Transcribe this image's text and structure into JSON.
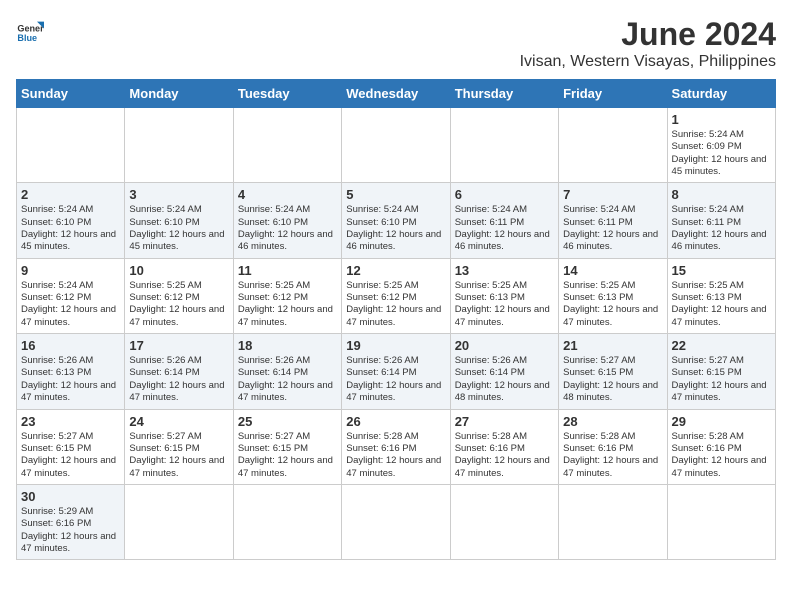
{
  "header": {
    "logo_general": "General",
    "logo_blue": "Blue",
    "month_title": "June 2024",
    "subtitle": "Ivisan, Western Visayas, Philippines"
  },
  "weekdays": [
    "Sunday",
    "Monday",
    "Tuesday",
    "Wednesday",
    "Thursday",
    "Friday",
    "Saturday"
  ],
  "days": [
    {
      "date": "1",
      "sunrise": "5:24 AM",
      "sunset": "6:09 PM",
      "daylight": "12 hours and 45 minutes."
    },
    {
      "date": "2",
      "sunrise": "5:24 AM",
      "sunset": "6:10 PM",
      "daylight": "12 hours and 45 minutes."
    },
    {
      "date": "3",
      "sunrise": "5:24 AM",
      "sunset": "6:10 PM",
      "daylight": "12 hours and 45 minutes."
    },
    {
      "date": "4",
      "sunrise": "5:24 AM",
      "sunset": "6:10 PM",
      "daylight": "12 hours and 46 minutes."
    },
    {
      "date": "5",
      "sunrise": "5:24 AM",
      "sunset": "6:10 PM",
      "daylight": "12 hours and 46 minutes."
    },
    {
      "date": "6",
      "sunrise": "5:24 AM",
      "sunset": "6:11 PM",
      "daylight": "12 hours and 46 minutes."
    },
    {
      "date": "7",
      "sunrise": "5:24 AM",
      "sunset": "6:11 PM",
      "daylight": "12 hours and 46 minutes."
    },
    {
      "date": "8",
      "sunrise": "5:24 AM",
      "sunset": "6:11 PM",
      "daylight": "12 hours and 46 minutes."
    },
    {
      "date": "9",
      "sunrise": "5:24 AM",
      "sunset": "6:12 PM",
      "daylight": "12 hours and 47 minutes."
    },
    {
      "date": "10",
      "sunrise": "5:25 AM",
      "sunset": "6:12 PM",
      "daylight": "12 hours and 47 minutes."
    },
    {
      "date": "11",
      "sunrise": "5:25 AM",
      "sunset": "6:12 PM",
      "daylight": "12 hours and 47 minutes."
    },
    {
      "date": "12",
      "sunrise": "5:25 AM",
      "sunset": "6:12 PM",
      "daylight": "12 hours and 47 minutes."
    },
    {
      "date": "13",
      "sunrise": "5:25 AM",
      "sunset": "6:13 PM",
      "daylight": "12 hours and 47 minutes."
    },
    {
      "date": "14",
      "sunrise": "5:25 AM",
      "sunset": "6:13 PM",
      "daylight": "12 hours and 47 minutes."
    },
    {
      "date": "15",
      "sunrise": "5:25 AM",
      "sunset": "6:13 PM",
      "daylight": "12 hours and 47 minutes."
    },
    {
      "date": "16",
      "sunrise": "5:26 AM",
      "sunset": "6:13 PM",
      "daylight": "12 hours and 47 minutes."
    },
    {
      "date": "17",
      "sunrise": "5:26 AM",
      "sunset": "6:14 PM",
      "daylight": "12 hours and 47 minutes."
    },
    {
      "date": "18",
      "sunrise": "5:26 AM",
      "sunset": "6:14 PM",
      "daylight": "12 hours and 47 minutes."
    },
    {
      "date": "19",
      "sunrise": "5:26 AM",
      "sunset": "6:14 PM",
      "daylight": "12 hours and 47 minutes."
    },
    {
      "date": "20",
      "sunrise": "5:26 AM",
      "sunset": "6:14 PM",
      "daylight": "12 hours and 48 minutes."
    },
    {
      "date": "21",
      "sunrise": "5:27 AM",
      "sunset": "6:15 PM",
      "daylight": "12 hours and 48 minutes."
    },
    {
      "date": "22",
      "sunrise": "5:27 AM",
      "sunset": "6:15 PM",
      "daylight": "12 hours and 47 minutes."
    },
    {
      "date": "23",
      "sunrise": "5:27 AM",
      "sunset": "6:15 PM",
      "daylight": "12 hours and 47 minutes."
    },
    {
      "date": "24",
      "sunrise": "5:27 AM",
      "sunset": "6:15 PM",
      "daylight": "12 hours and 47 minutes."
    },
    {
      "date": "25",
      "sunrise": "5:27 AM",
      "sunset": "6:15 PM",
      "daylight": "12 hours and 47 minutes."
    },
    {
      "date": "26",
      "sunrise": "5:28 AM",
      "sunset": "6:16 PM",
      "daylight": "12 hours and 47 minutes."
    },
    {
      "date": "27",
      "sunrise": "5:28 AM",
      "sunset": "6:16 PM",
      "daylight": "12 hours and 47 minutes."
    },
    {
      "date": "28",
      "sunrise": "5:28 AM",
      "sunset": "6:16 PM",
      "daylight": "12 hours and 47 minutes."
    },
    {
      "date": "29",
      "sunrise": "5:28 AM",
      "sunset": "6:16 PM",
      "daylight": "12 hours and 47 minutes."
    },
    {
      "date": "30",
      "sunrise": "5:29 AM",
      "sunset": "6:16 PM",
      "daylight": "12 hours and 47 minutes."
    }
  ]
}
